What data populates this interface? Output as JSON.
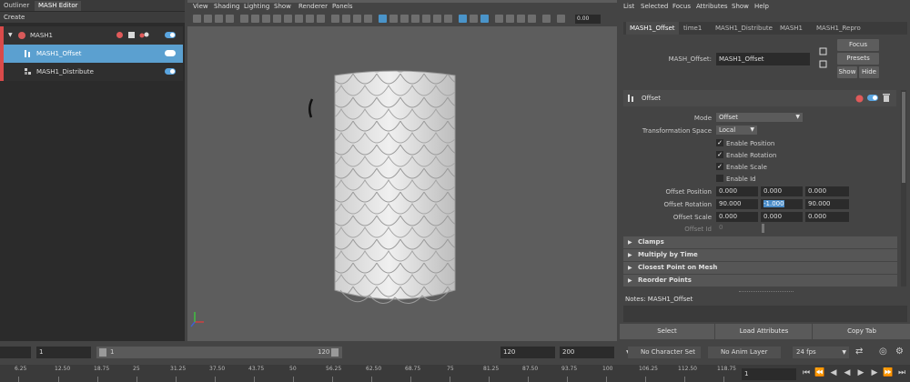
{
  "left": {
    "tabs": [
      "Outliner",
      "MASH Editor"
    ],
    "create_label": "Create",
    "rows": [
      {
        "label": "MASH1"
      },
      {
        "label": "MASH1_Offset"
      },
      {
        "label": "MASH1_Distribute"
      }
    ]
  },
  "viewport": {
    "menu": [
      "View",
      "Shading",
      "Lighting",
      "Show",
      "Renderer",
      "Panels"
    ],
    "value": "0.00"
  },
  "right": {
    "menu": [
      "List",
      "Selected",
      "Focus",
      "Attributes",
      "Show",
      "Help"
    ],
    "tabs": [
      "MASH1_Offset",
      "time1",
      "MASH1_Distribute",
      "MASH1",
      "MASH1_Repro"
    ],
    "node_label": "MASH_Offset:",
    "node_value": "MASH1_Offset",
    "focus": "Focus",
    "presets": "Presets",
    "show": "Show",
    "hide": "Hide",
    "section_title": "Offset",
    "mode_label": "Mode",
    "mode_value": "Offset",
    "space_label": "Transformation Space",
    "space_value": "Local",
    "checks": [
      "Enable Position",
      "Enable Rotation",
      "Enable Scale",
      "Enable Id"
    ],
    "offset_position_label": "Offset Position",
    "offset_position": [
      "0.000",
      "0.000",
      "0.000"
    ],
    "offset_rotation_label": "Offset Rotation",
    "offset_rotation": [
      "90.000",
      "-1.000",
      "90.000"
    ],
    "offset_scale_label": "Offset Scale",
    "offset_scale": [
      "0.000",
      "0.000",
      "0.000"
    ],
    "offset_id_label": "Offset Id",
    "offset_id": "0",
    "sections": [
      "Clamps",
      "Multiply by Time",
      "Closest Point on Mesh",
      "Reorder Points"
    ],
    "notes": "Notes:  MASH1_Offset",
    "select": "Select",
    "load": "Load Attributes",
    "copy": "Copy Tab"
  },
  "range": {
    "start": "1",
    "inner_start": "1",
    "inner_end": "120",
    "end": "120",
    "max": "200",
    "char_set": "No Character Set",
    "anim_layer": "No Anim Layer",
    "fps": "24 fps"
  },
  "timeline": {
    "ticks": [
      "6.25",
      "12.50",
      "18.75",
      "25",
      "31.25",
      "37.50",
      "43.75",
      "50",
      "56.25",
      "62.50",
      "68.75",
      "75",
      "81.25",
      "87.50",
      "93.75",
      "100",
      "106.25",
      "112.50",
      "118.75"
    ],
    "current": "1"
  },
  "colors": {
    "selection": "#5ba0d0",
    "accent_red": "#d94a4a"
  }
}
